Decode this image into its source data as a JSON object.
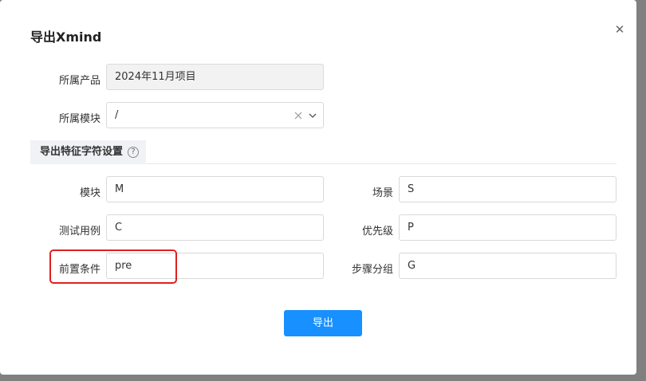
{
  "dialog": {
    "title": "导出Xmind",
    "close_glyph": "✕"
  },
  "form": {
    "product": {
      "label": "所属产品",
      "value": "2024年11月项目"
    },
    "module": {
      "label": "所属模块",
      "value": "/"
    }
  },
  "section": {
    "title": "导出特征字符设置",
    "help_glyph": "?"
  },
  "fields": {
    "module_char": {
      "label": "模块",
      "value": "M"
    },
    "scene_char": {
      "label": "场景",
      "value": "S"
    },
    "case_char": {
      "label": "测试用例",
      "value": "C"
    },
    "priority_char": {
      "label": "优先级",
      "value": "P"
    },
    "precondition_char": {
      "label": "前置条件",
      "value": "pre"
    },
    "step_group_char": {
      "label": "步骤分组",
      "value": "G"
    }
  },
  "actions": {
    "export_label": "导出"
  },
  "colors": {
    "primary": "#1890ff",
    "highlight": "#e02020",
    "overlay": "#808080"
  }
}
